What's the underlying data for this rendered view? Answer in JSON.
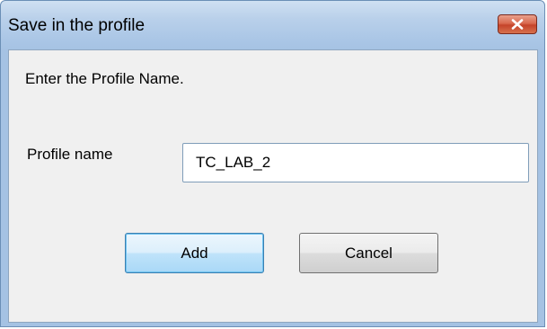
{
  "window": {
    "title": "Save in the profile",
    "close_icon": "close-x-icon"
  },
  "dialog": {
    "prompt": "Enter the Profile Name.",
    "profile_name_label": "Profile name",
    "profile_name_value": "TC_LAB_2",
    "add_label": "Add",
    "cancel_label": "Cancel"
  },
  "colors": {
    "frame": "#aac6e6",
    "client": "#f0f0f0",
    "close_button": "#c5432a",
    "default_button_border": "#3c7fb1"
  }
}
